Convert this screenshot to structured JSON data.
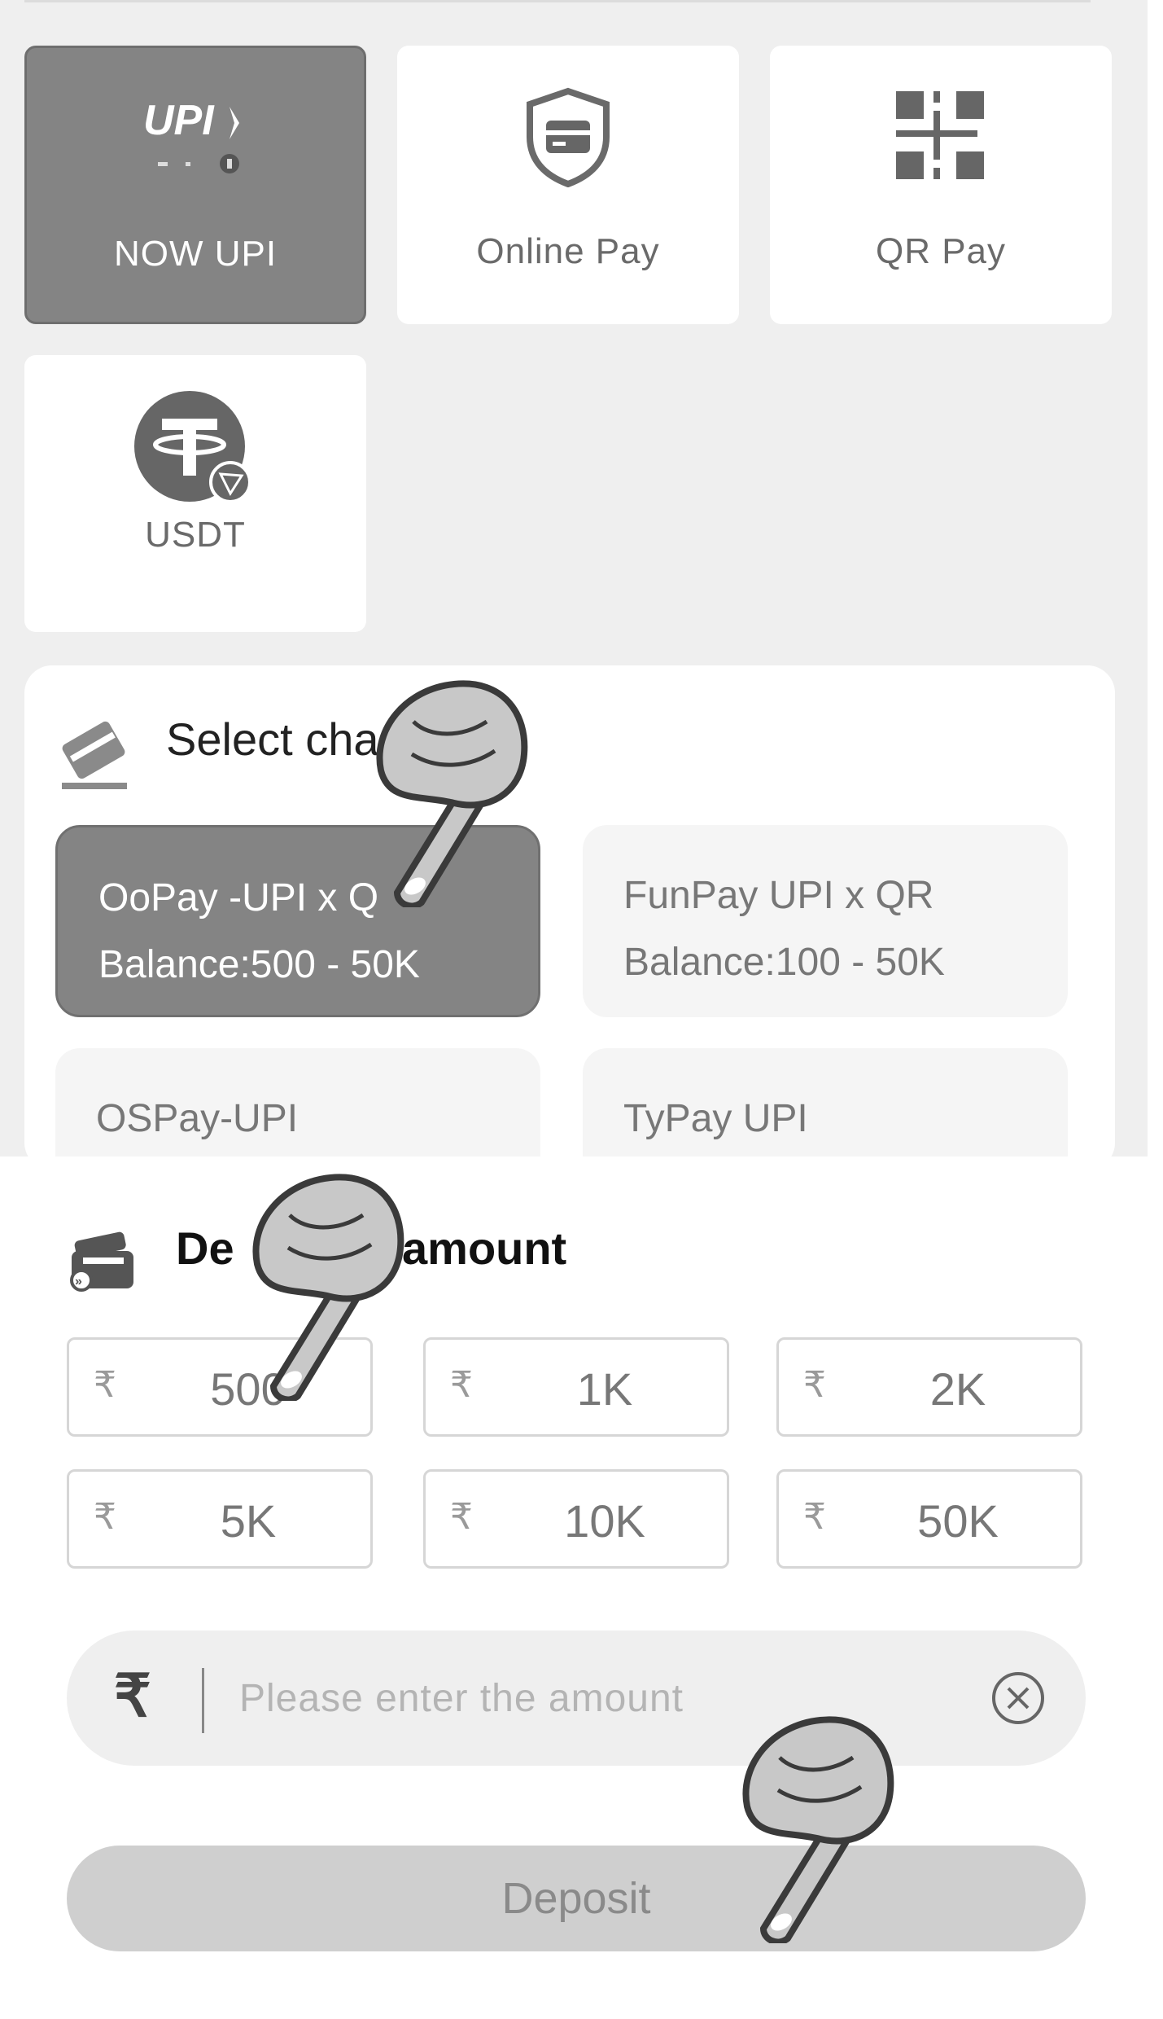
{
  "methods": [
    {
      "label": "NOW UPI",
      "logo": "UPI",
      "icon": "upi-logo-icon",
      "active": true
    },
    {
      "label": "Online Pay",
      "icon": "shield-card-icon",
      "active": false
    },
    {
      "label": "QR Pay",
      "icon": "qr-code-icon",
      "active": false
    },
    {
      "label": "USDT",
      "icon": "tether-icon",
      "active": false
    }
  ],
  "channel": {
    "title": "Select cha",
    "icon": "card-hand-icon",
    "items": [
      {
        "name": "OoPay -UPI x Q",
        "balance": "Balance:500 - 50K",
        "active": true
      },
      {
        "name": "FunPay UPI x QR",
        "balance": "Balance:100 - 50K",
        "active": false
      },
      {
        "name": "OSPay-UPI",
        "balance": "",
        "active": false
      },
      {
        "name": "TyPay UPI",
        "balance": "",
        "active": false
      }
    ]
  },
  "deposit": {
    "title_left": "De",
    "title_right": "amount",
    "icon": "wallet-icon",
    "currency_symbol": "₹",
    "amounts": [
      "500",
      "1K",
      "2K",
      "5K",
      "10K",
      "50K"
    ],
    "input_placeholder": "Please enter the amount",
    "clear_icon": "clear-circle-icon",
    "button_label": "Deposit"
  },
  "overlays": {
    "pointer_icon": "pointing-hand-icon"
  },
  "colors": {
    "active_tile": "#848484",
    "background": "#efefef",
    "card": "#ffffff",
    "button_disabled": "#cfcfcf"
  }
}
